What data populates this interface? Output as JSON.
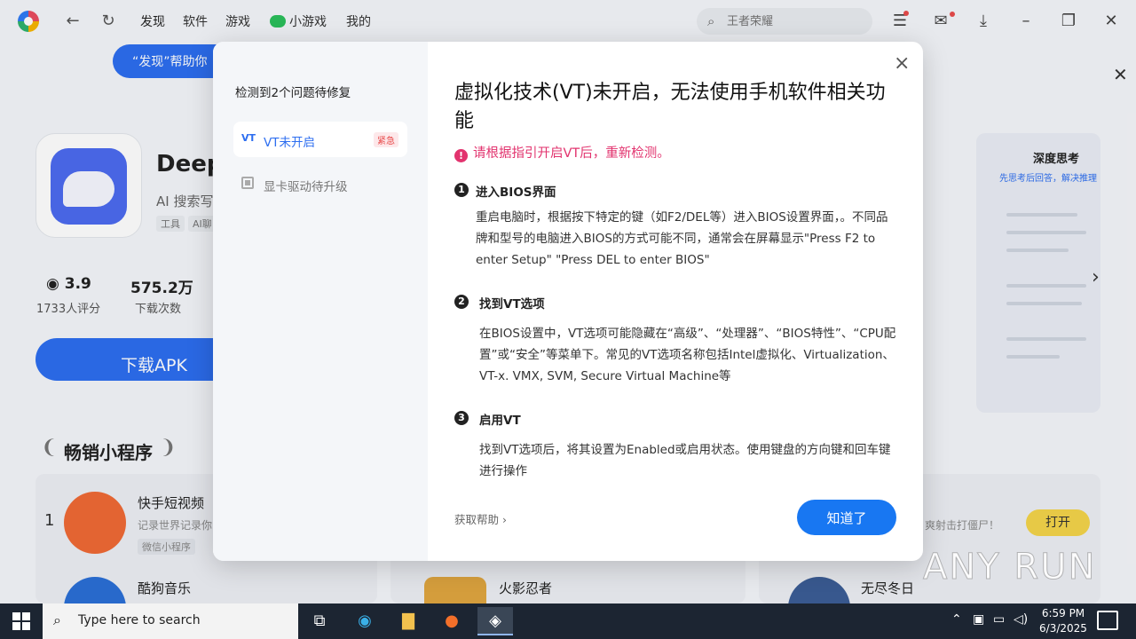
{
  "topbar": {
    "tabs": [
      "发现",
      "软件",
      "游戏",
      "小游戏",
      "我的"
    ],
    "search_placeholder": "王者荣耀"
  },
  "banner": {
    "tooltip": "“发现”帮助你"
  },
  "app": {
    "name": "DeepS",
    "subtitle": "AI 搜索写",
    "tags": [
      "工具",
      "AI聊"
    ],
    "rating": "3.9",
    "rating_label": "1733人评分",
    "downloads": "575.2万",
    "downloads_label": "下载次数",
    "download_button": "下载APK"
  },
  "mini_programs": {
    "title": "畅销小程序",
    "items": [
      {
        "rank": "1",
        "name": "快手短视频",
        "desc": "记录世界记录你",
        "tag": "微信小程序"
      },
      {
        "name": "酷狗音乐"
      },
      {
        "name": "火影忍者"
      },
      {
        "name": "无尽冬日"
      }
    ],
    "right_desc": "爽射击打僵尸！",
    "right_open": "打开"
  },
  "preview": {
    "title": "深度思考",
    "subtitle": "先思考后回答，解决推理"
  },
  "dialog": {
    "sidebar_title": "检测到2个问题待修复",
    "issues": [
      {
        "icon": "VT",
        "label": "VT未开启",
        "badge": "紧急"
      },
      {
        "label": "显卡驱动待升级"
      }
    ],
    "title": "虚拟化技术(VT)未开启，无法使用手机软件相关功能",
    "warning": "请根据指引开启VT后，重新检测。",
    "steps": [
      {
        "num": "1",
        "title": "进入BIOS界面",
        "body": "重启电脑时，根据按下特定的键（如F2/DEL等）进入BIOS设置界面，。不同品牌和型号的电脑进入BIOS的方式可能不同，通常会在屏幕显示\"Press F2 to enter Setup\" \"Press DEL to enter BIOS\""
      },
      {
        "num": "2",
        "title": "找到VT选项",
        "body": "在BIOS设置中，VT选项可能隐藏在“高级”、“处理器”、“BIOS特性”、“CPU配置”或“安全”等菜单下。常见的VT选项名称包括Intel虚拟化、Virtualization、VT-x. VMX, SVM, Secure Virtual Machine等"
      },
      {
        "num": "3",
        "title": "启用VT",
        "body": "找到VT选项后，将其设置为Enabled或启用状态。使用键盘的方向键和回车键进行操作"
      }
    ],
    "help_link": "获取帮助",
    "ok_button": "知道了"
  },
  "watermark": "ANY RUN",
  "taskbar": {
    "search_placeholder": "Type here to search",
    "time": "6:59 PM",
    "date": "6/3/2025"
  },
  "colors": {
    "accent": "#1877f2",
    "warning": "#e2336e",
    "urgent": "#e84b4b"
  }
}
